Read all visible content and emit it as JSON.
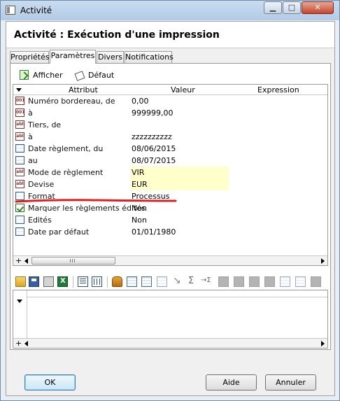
{
  "window": {
    "title": "Activité",
    "controls": {
      "minimize": "▁",
      "maximize": "□",
      "close": "✕"
    }
  },
  "heading": "Activité : Exécution d'une impression",
  "tabs": [
    {
      "label": "Propriétés",
      "active": false
    },
    {
      "label": "Paramètres",
      "active": true
    },
    {
      "label": "Divers",
      "active": false
    },
    {
      "label": "Notifications",
      "active": false
    }
  ],
  "toolbar": {
    "afficher": "Afficher",
    "defaut": "Défaut"
  },
  "grid": {
    "columns": {
      "attribut": "Attribut",
      "valeur": "Valeur",
      "expression": "Expression"
    },
    "rows": [
      {
        "icon": "numeric-field-icon",
        "glyph": "001",
        "attribut": "Numéro bordereau, de",
        "valeur": "0,00",
        "highlight": false
      },
      {
        "icon": "numeric-field-icon",
        "glyph": "001",
        "attribut": "à",
        "valeur": "999999,00",
        "highlight": false
      },
      {
        "icon": "text-field-icon",
        "glyph": "abl",
        "attribut": "Tiers, de",
        "valeur": "",
        "highlight": false
      },
      {
        "icon": "text-field-icon",
        "glyph": "abl",
        "attribut": "à",
        "valeur": "zzzzzzzzzz",
        "highlight": false
      },
      {
        "icon": "date-field-icon",
        "glyph": "",
        "attribut": "Date règlement, du",
        "valeur": "08/06/2015",
        "highlight": false
      },
      {
        "icon": "date-field-icon",
        "glyph": "",
        "attribut": "au",
        "valeur": "08/07/2015",
        "highlight": false
      },
      {
        "icon": "text-field-icon",
        "glyph": "abl",
        "attribut": "Mode de règlement",
        "valeur": "VIR",
        "highlight": true
      },
      {
        "icon": "text-field-icon",
        "glyph": "abl",
        "attribut": "Devise",
        "valeur": "EUR",
        "highlight": true
      },
      {
        "icon": "list-field-icon",
        "glyph": "",
        "attribut": "Format",
        "valeur": "Processus",
        "highlight": false
      },
      {
        "icon": "checkbox-field-icon",
        "glyph": "",
        "attribut": "Marquer les règlements édités",
        "valeur": "Non",
        "highlight": false
      },
      {
        "icon": "list-field-icon",
        "glyph": "",
        "attribut": "Edités",
        "valeur": "Non",
        "highlight": false
      },
      {
        "icon": "date-field-icon",
        "glyph": "",
        "attribut": "Date par défaut",
        "valeur": "01/01/1980",
        "highlight": false
      }
    ],
    "scroll_plus": "+"
  },
  "colors": {
    "highlight": "#ffffcc",
    "annotation_red": "#e02020",
    "accent": "#3c7fb1"
  },
  "buttons": {
    "ok": "OK",
    "aide": "Aide",
    "annuler": "Annuler"
  }
}
